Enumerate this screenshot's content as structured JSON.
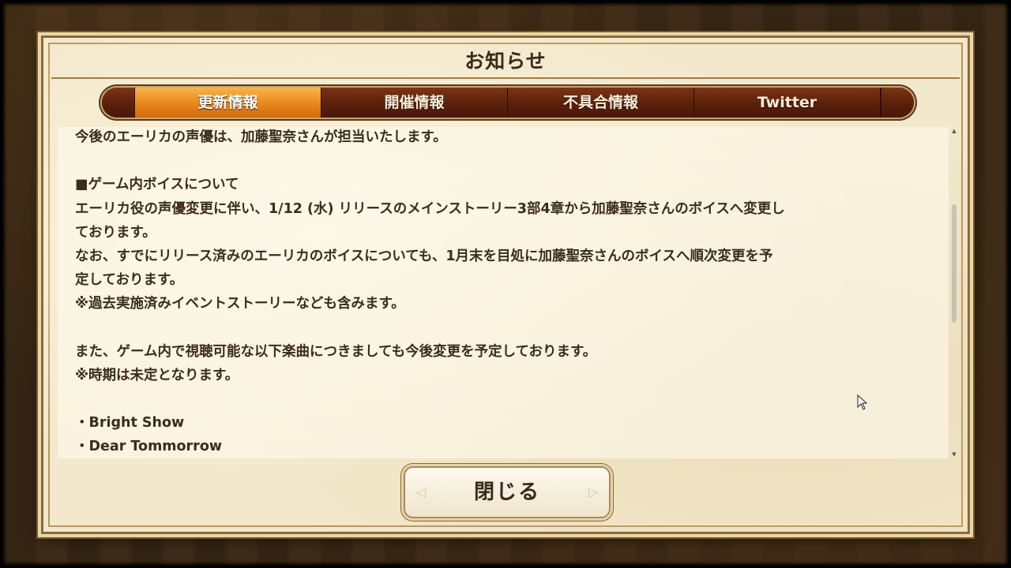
{
  "dialog": {
    "title": "お知らせ",
    "tabs": [
      {
        "label": "更新情報",
        "active": true
      },
      {
        "label": "開催情報",
        "active": false
      },
      {
        "label": "不具合情報",
        "active": false
      },
      {
        "label": "Twitter",
        "active": false
      }
    ],
    "content_lines": [
      "今後のエーリカの声優は、加藤聖奈さんが担当いたします。",
      "",
      "■ゲーム内ボイスについて",
      "エーリカ役の声優変更に伴い、1/12 (水) リリースのメインストーリー3部4章から加藤聖奈さんのボイスへ変更し",
      "ております。",
      "なお、すでにリリース済みのエーリカのボイスについても、1月末を目処に加藤聖奈さんのボイスへ順次変更を予",
      "定しております。",
      "※過去実施済みイベントストーリーなども含みます。",
      "",
      "また、ゲーム内で視聴可能な以下楽曲につきましても今後変更を予定しております。",
      "※時期は未定となります。",
      "",
      "・Bright Show",
      "・Dear Tommorrow"
    ],
    "scroll_position": 0.35,
    "close_label": "閉じる"
  },
  "colors": {
    "tab_active": "#e8861b",
    "tab_inactive": "#5a200a",
    "panel": "#f3e8cc",
    "text": "#3b2c1e"
  }
}
